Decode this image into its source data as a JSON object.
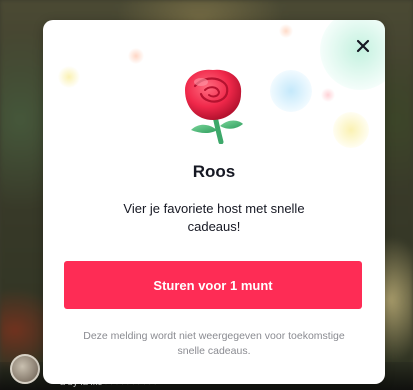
{
  "modal": {
    "gift_icon": "rose-icon",
    "title": "Roos",
    "subtitle": "Vier je favoriete host met snelle cadeaus!",
    "send_button_label": "Sturen voor 1 munt",
    "disclaimer": "Deze melding wordt niet weergegeven voor toekomstige snelle cadeaus.",
    "close_icon": "close-icon",
    "colors": {
      "accent": "#fe2c55",
      "text": "#161823",
      "muted": "#8a8b91"
    }
  },
  "background": {
    "comment_text": "a by la lko >>>>>>>>>>"
  }
}
